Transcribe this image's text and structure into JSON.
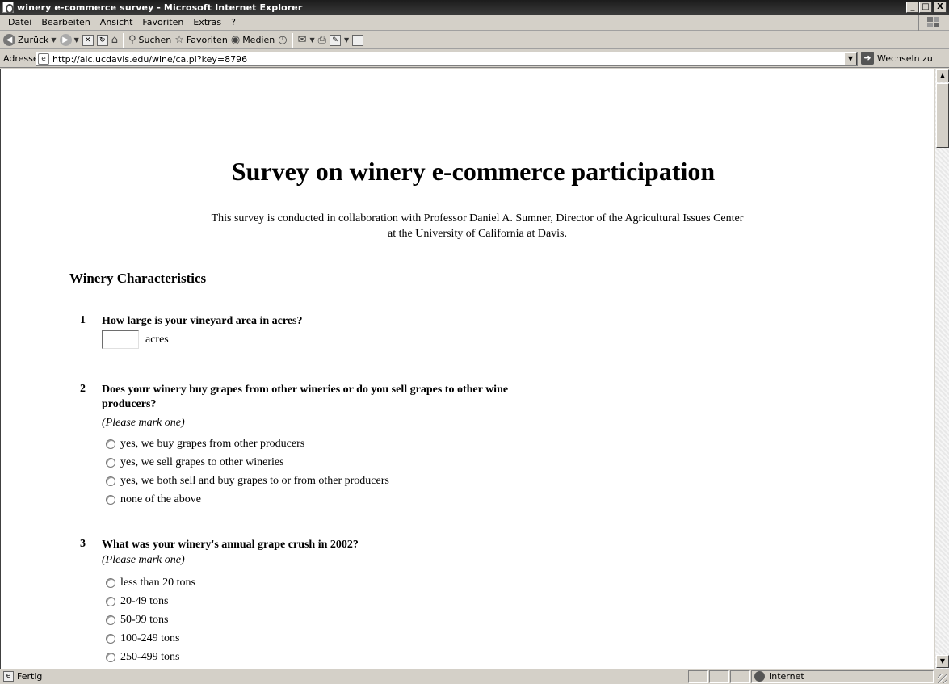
{
  "window": {
    "title": "winery e-commerce survey - Microsoft Internet Explorer",
    "minimize": "_",
    "maximize": "□",
    "close": "X"
  },
  "menu": {
    "items": [
      "Datei",
      "Bearbeiten",
      "Ansicht",
      "Favoriten",
      "Extras",
      "?"
    ]
  },
  "toolbar": {
    "back": "Zurück",
    "search": "Suchen",
    "favorites": "Favoriten",
    "media": "Medien"
  },
  "address": {
    "label": "Adresse",
    "url": "http://aic.ucdavis.edu/wine/ca.pl?key=8796",
    "go": "Wechseln zu"
  },
  "page": {
    "title": "Survey on winery e-commerce participation",
    "intro_line1": "This survey is conducted in collaboration with Professor Daniel A. Sumner, Director of the Agricultural Issues Center",
    "intro_line2": "at the University of California at Davis.",
    "section": "Winery Characteristics",
    "questions": [
      {
        "number": "1",
        "text": "How large is your vineyard area in acres?",
        "unit": "acres"
      },
      {
        "number": "2",
        "text_line1": "Does your winery buy grapes from other wineries or do you sell grapes to other wine",
        "text_line2": "producers?",
        "hint": "(Please mark one)",
        "options": [
          "yes, we buy grapes from other producers",
          "yes, we sell grapes to other wineries",
          "yes, we both sell and buy grapes to or from other producers",
          "none of the above"
        ]
      },
      {
        "number": "3",
        "text": "What was your winery's annual grape crush in 2002?",
        "hint": "(Please mark one)",
        "options": [
          "less than 20 tons",
          "20-49 tons",
          "50-99 tons",
          "100-249 tons",
          "250-499 tons"
        ]
      }
    ]
  },
  "status": {
    "text": "Fertig",
    "zone": "Internet"
  }
}
